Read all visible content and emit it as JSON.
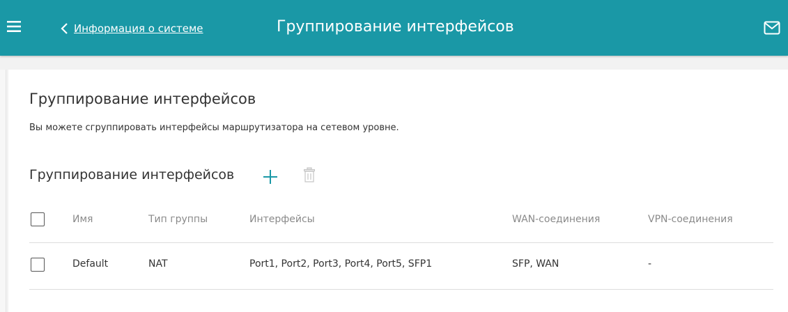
{
  "topbar": {
    "back_label": "Информация о системе",
    "title": "Группирование интерфейсов",
    "color": "#1a98a6"
  },
  "section": {
    "title": "Группирование интерфейсов",
    "description": "Вы можете сгруппировать интерфейсы маршрутизатора на сетевом уровне."
  },
  "table": {
    "title": "Группирование интерфейсов",
    "columns": [
      "Имя",
      "Тип группы",
      "Интерфейсы",
      "WAN-соединения",
      "VPN-соединения"
    ],
    "rows": [
      [
        "Default",
        "NAT",
        "Port1, Port2, Port3, Port4, Port5, SFP1",
        "SFP, WAN",
        "-"
      ]
    ]
  },
  "icons": {
    "menu": "hamburger-menu-icon",
    "back": "chevron-left-icon",
    "mail": "envelope-icon",
    "add": "plus-icon",
    "delete": "trash-icon"
  }
}
